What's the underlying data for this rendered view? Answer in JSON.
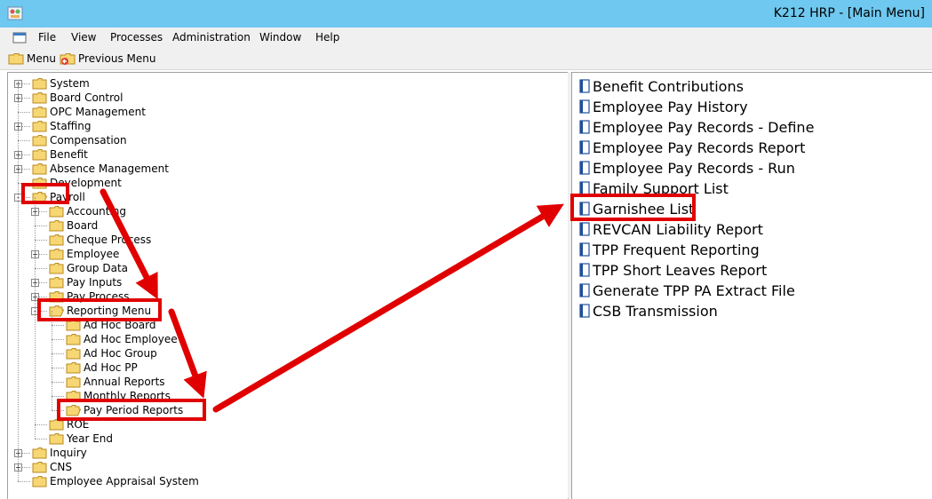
{
  "window": {
    "title": "K212 HRP - [Main Menu]"
  },
  "menubar": {
    "items": [
      {
        "label": "File"
      },
      {
        "label": "View"
      },
      {
        "label": "Processes"
      },
      {
        "label": "Administration"
      },
      {
        "label": "Window"
      },
      {
        "label": "Help"
      }
    ]
  },
  "toolbar": {
    "menu_label": "Menu",
    "previous_label": "Previous Menu"
  },
  "tree": {
    "root": [
      {
        "label": "System",
        "expander": "+"
      },
      {
        "label": "Board Control",
        "expander": "+"
      },
      {
        "label": "OPC Management",
        "expander": ""
      },
      {
        "label": "Staffing",
        "expander": "+"
      },
      {
        "label": "Compensation",
        "expander": ""
      },
      {
        "label": "Benefit",
        "expander": "+"
      },
      {
        "label": "Absence Management",
        "expander": "+"
      },
      {
        "label": "Development",
        "expander": ""
      },
      {
        "label": "Payroll",
        "expander": "-"
      }
    ],
    "payroll_children": [
      {
        "label": "Accounting",
        "expander": "+"
      },
      {
        "label": "Board",
        "expander": ""
      },
      {
        "label": "Cheque Process",
        "expander": ""
      },
      {
        "label": "Employee",
        "expander": "+"
      },
      {
        "label": "Group Data",
        "expander": ""
      },
      {
        "label": "Pay Inputs",
        "expander": "+"
      },
      {
        "label": "Pay Process",
        "expander": "+"
      },
      {
        "label": "Reporting Menu",
        "expander": "-"
      }
    ],
    "reporting_children": [
      {
        "label": "Ad Hoc Board"
      },
      {
        "label": "Ad Hoc Employee"
      },
      {
        "label": "Ad Hoc Group"
      },
      {
        "label": "Ad Hoc PP"
      },
      {
        "label": "Annual Reports"
      },
      {
        "label": "Monthly Reports"
      },
      {
        "label": "Pay Period Reports"
      }
    ],
    "payroll_tail": [
      {
        "label": "ROE",
        "expander": ""
      },
      {
        "label": "Year End",
        "expander": ""
      }
    ],
    "root_tail": [
      {
        "label": "Inquiry",
        "expander": "+"
      },
      {
        "label": "CNS",
        "expander": "+"
      },
      {
        "label": "Employee Appraisal System",
        "expander": ""
      }
    ]
  },
  "reports": [
    {
      "label": "Benefit Contributions"
    },
    {
      "label": "Employee Pay History"
    },
    {
      "label": "Employee Pay Records - Define"
    },
    {
      "label": "Employee Pay Records Report"
    },
    {
      "label": "Employee Pay Records - Run"
    },
    {
      "label": "Family Support List"
    },
    {
      "label": "Garnishee List"
    },
    {
      "label": "REVCAN Liability Report"
    },
    {
      "label": "TPP Frequent Reporting"
    },
    {
      "label": "TPP Short Leaves Report"
    },
    {
      "label": "Generate TPP PA Extract File"
    },
    {
      "label": "CSB Transmission"
    }
  ],
  "colors": {
    "titlebar": "#6fc8ef",
    "annotation_red": "#e00000",
    "folder_fill": "#f7d774",
    "folder_stroke": "#b98a1d"
  }
}
